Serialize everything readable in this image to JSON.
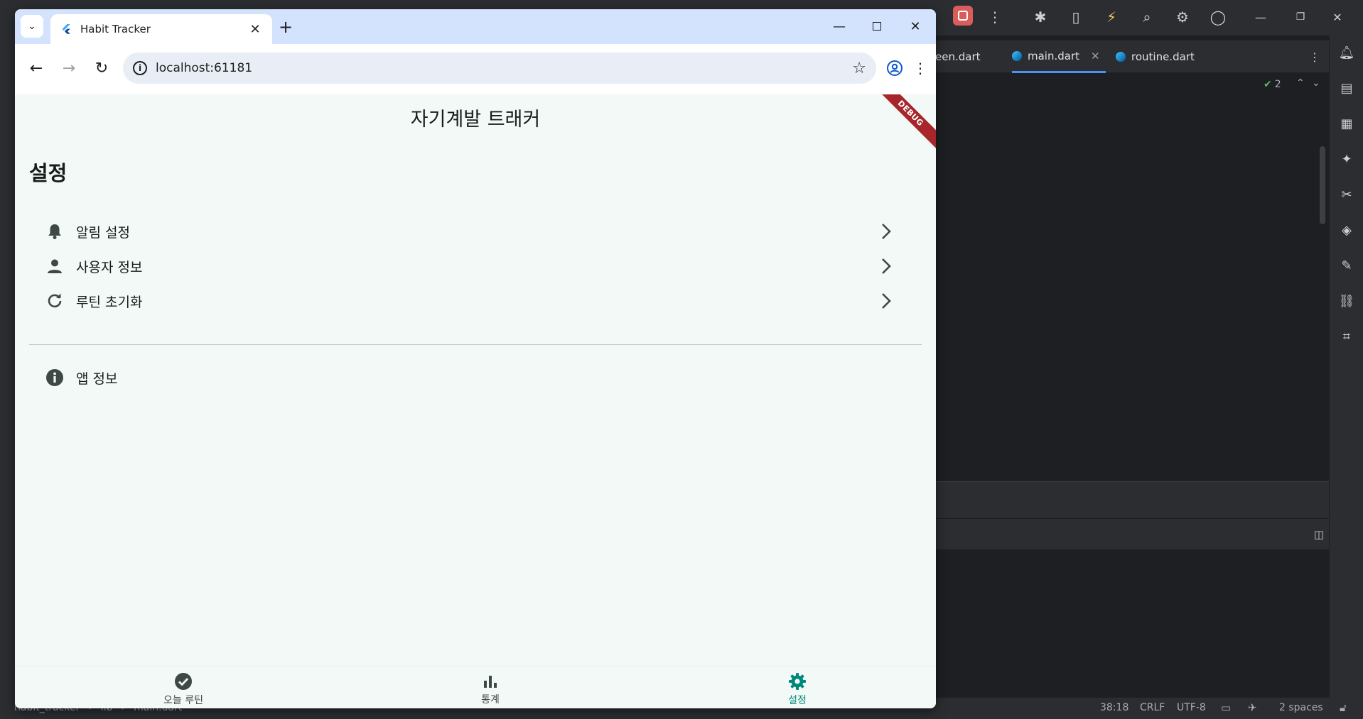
{
  "browser": {
    "tab_title": "Habit Tracker",
    "url": "localhost:61181"
  },
  "app": {
    "title": "자기계발 트래커",
    "debug_banner": "DEBUG",
    "section_title": "설정",
    "settings_items": [
      {
        "label": "알림 설정",
        "icon": "bell-icon"
      },
      {
        "label": "사용자 정보",
        "icon": "person-icon"
      },
      {
        "label": "루틴 초기화",
        "icon": "refresh-icon"
      }
    ],
    "info_item": {
      "label": "앱 정보",
      "icon": "info-icon"
    },
    "bottom_nav": [
      {
        "label": "오늘 루틴",
        "icon": "check-circle-icon",
        "active": false
      },
      {
        "label": "통계",
        "icon": "bar-chart-icon",
        "active": false
      },
      {
        "label": "설정",
        "icon": "gear-icon",
        "active": true
      }
    ],
    "accent_color": "#00897b"
  },
  "ide": {
    "tabs": [
      "een.dart",
      "main.dart",
      "routine.dart"
    ],
    "problems_count": "2",
    "breadcrumb": [
      "habit_tracker",
      "lib",
      "main.dart"
    ],
    "status": {
      "position": "38:18",
      "line_ending": "CRLF",
      "encoding": "UTF-8",
      "indent": "2 spaces"
    }
  }
}
